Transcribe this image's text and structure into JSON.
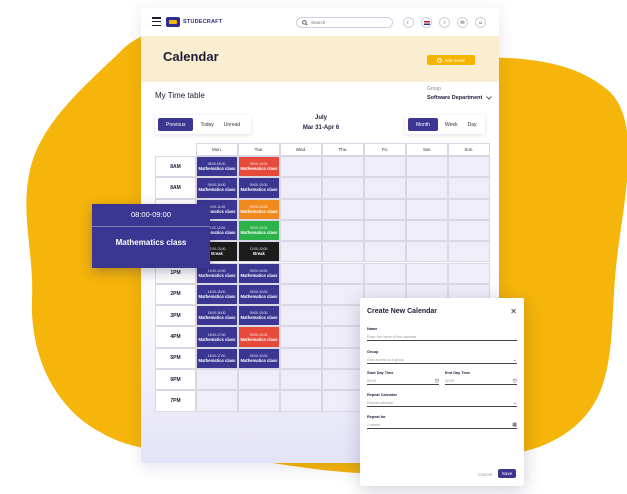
{
  "colors": {
    "accent": "#3b3692",
    "brand_yellow": "#f5b400",
    "event_red": "#e64a3b",
    "event_orange": "#f08a1f",
    "event_green": "#2db24a",
    "event_black": "#1c1c1c"
  },
  "topbar": {
    "logo_text": "STUDECRAFT",
    "search_placeholder": "Search",
    "icons": [
      "menu-icon",
      "moon-icon",
      "flag-icon",
      "settings-icon",
      "mail-icon",
      "user-icon"
    ]
  },
  "header": {
    "title": "Calendar",
    "add_event_label": "Add event"
  },
  "toolbar": {
    "timetable_title": "My Time table",
    "group_label": "Group",
    "group_value": "Software Department",
    "nav_buttons": [
      "Previous",
      "Today",
      "Unread"
    ],
    "month": "July",
    "range": "Mar 31-Apr 6",
    "view_buttons": [
      "Month",
      "Week",
      "Day"
    ]
  },
  "grid": {
    "days": [
      "Mon.",
      "Tue.",
      "Wed.",
      "Thu.",
      "Fri.",
      "Sat.",
      "Sun."
    ],
    "hours": [
      "8AM",
      "8AM",
      "",
      "",
      "",
      "1PM",
      "2PM",
      "3PM",
      "4PM",
      "5PM",
      "6PM",
      "7PM"
    ],
    "events": {
      "mon": [
        {
          "time": "08:00-09:00.",
          "name": "Mathematics class"
        },
        {
          "time": "09:00-10:00.",
          "name": "Mathematics class"
        },
        {
          "time": "10:00-11:00.",
          "name": "Mathematics class"
        },
        {
          "time": "11:00-12:00.",
          "name": "Mathematics class"
        },
        {
          "time": "12:00-13:00.",
          "name": "Break"
        },
        {
          "time": "13:00-14:00.",
          "name": "Mathematics class"
        },
        {
          "time": "14:00-15:00.",
          "name": "Mathematics class"
        },
        {
          "time": "15:00-16:00.",
          "name": "Mathematics class"
        },
        {
          "time": "16:00-17:00.",
          "name": "Mathematics class"
        },
        {
          "time": "16:00-17:00.",
          "name": "Mathematics class"
        }
      ],
      "tue": [
        {
          "time": "09:00-10:00.",
          "name": "Mathematics class"
        },
        {
          "time": "09:00-10:00.",
          "name": "Mathematics class"
        },
        {
          "time": "09:00-10:00.",
          "name": "Mathematics class"
        },
        {
          "time": "09:00-10:00.",
          "name": "Mathematics class"
        },
        {
          "time": "12:00-13:00.",
          "name": "Break"
        },
        {
          "time": "09:00-10:00.",
          "name": "Mathematics class"
        },
        {
          "time": "09:00-10:00.",
          "name": "Mathematics class"
        },
        {
          "time": "09:00-10:00.",
          "name": "Mathematics class"
        },
        {
          "time": "09:00-10:00.",
          "name": "Mathematics class"
        },
        {
          "time": "09:00-10:00.",
          "name": "Mathematics class"
        }
      ]
    }
  },
  "popup": {
    "time": "08:00-09:00",
    "name": "Mathematics class"
  },
  "modal": {
    "title": "Create New Calendar",
    "name_label": "Name",
    "name_placeholder": "Enter the name of the calendar",
    "group_label": "Group",
    "group_placeholder": "Give access to a group",
    "start_label": "Start Day Time",
    "start_value": "00:00",
    "end_label": "End Day Time",
    "end_value": "00:00",
    "repeat_label": "Repeat Calendar",
    "repeat_placeholder": "Repeat calendar",
    "repeat_for_label": "Repeat for",
    "repeat_for_value": "2 weeks",
    "cancel_label": "Cancel",
    "save_label": "Save"
  }
}
